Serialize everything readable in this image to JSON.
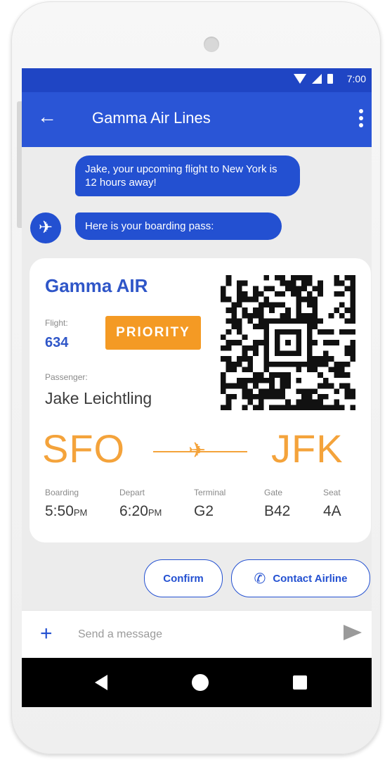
{
  "status_bar": {
    "time": "7:00"
  },
  "app_bar": {
    "title": "Gamma Air Lines",
    "back_icon": "arrow-back-icon",
    "menu_icon": "more-vert-icon"
  },
  "messages": [
    {
      "text": "Jake, your upcoming flight to New York is 12 hours away!"
    },
    {
      "text": "Here is your boarding pass:"
    }
  ],
  "boarding_pass": {
    "brand": "Gamma AIR",
    "flight_label": "Flight:",
    "flight_number": "634",
    "priority": "PRIORITY",
    "passenger_label": "Passenger:",
    "passenger_name": "Jake Leichtling",
    "from": "SFO",
    "to": "JFK",
    "details": [
      {
        "label": "Boarding",
        "value": "5:50",
        "suffix": "PM"
      },
      {
        "label": "Depart",
        "value": "6:20",
        "suffix": "PM"
      },
      {
        "label": "Terminal",
        "value": "G2",
        "suffix": ""
      },
      {
        "label": "Gate",
        "value": "B42",
        "suffix": ""
      },
      {
        "label": "Seat",
        "value": "4A",
        "suffix": ""
      }
    ],
    "accent_color": "#f4a33b",
    "brand_color": "#2f56c8"
  },
  "suggestions": {
    "confirm": "Confirm",
    "contact": "Contact Airline"
  },
  "composer": {
    "placeholder": "Send a message"
  },
  "colors": {
    "primary": "#2350d1",
    "status_bar": "#1f45c4",
    "priority": "#f49a24"
  }
}
